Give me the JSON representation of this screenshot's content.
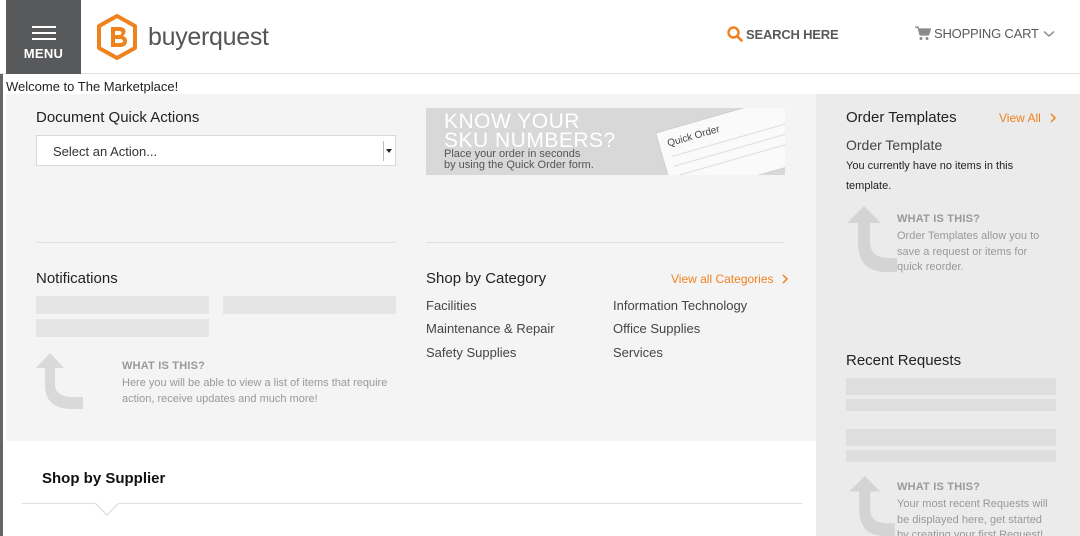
{
  "header": {
    "menu_label": "MENU",
    "logo_text": "buyerquest",
    "search_label": "SEARCH HERE",
    "cart_label": "SHOPPING CART",
    "accent_color": "#f0821e"
  },
  "welcome": "Welcome to The Marketplace!",
  "quick_actions": {
    "title": "Document Quick Actions",
    "select_value": "Select an Action..."
  },
  "banner": {
    "line1": "KNOW YOUR",
    "line2": "SKU NUMBERS?",
    "desc1": "Place your order in seconds",
    "desc2": "by using the Quick Order form.",
    "form_title": "Quick Order"
  },
  "notifications": {
    "title": "Notifications",
    "what_title": "WHAT IS THIS?",
    "what_line1": "Here you will be able to view a list of items that require",
    "what_line2": "action, receive updates and much more!"
  },
  "categories": {
    "title": "Shop by Category",
    "view_all": "View all Categories",
    "items": [
      "Facilities",
      "Maintenance & Repair",
      "Safety Supplies",
      "Information Technology",
      "Office Supplies",
      "Services"
    ]
  },
  "order_templates": {
    "title": "Order Templates",
    "view_all": "View All",
    "subtitle": "Order Template",
    "empty_line1": "You currently have no items in this",
    "empty_line2": "template.",
    "what_title": "WHAT IS THIS?",
    "what_line1": "Order Templates allow you to",
    "what_line2": "save a request or items for",
    "what_line3": "quick reorder."
  },
  "recent_requests": {
    "title": "Recent Requests",
    "what_title": "WHAT IS THIS?",
    "what_line1": "Your most recent Requests will",
    "what_line2": "be displayed here, get started",
    "what_line3": "by creating your first Request!"
  },
  "supplier": {
    "title": "Shop by Supplier"
  }
}
